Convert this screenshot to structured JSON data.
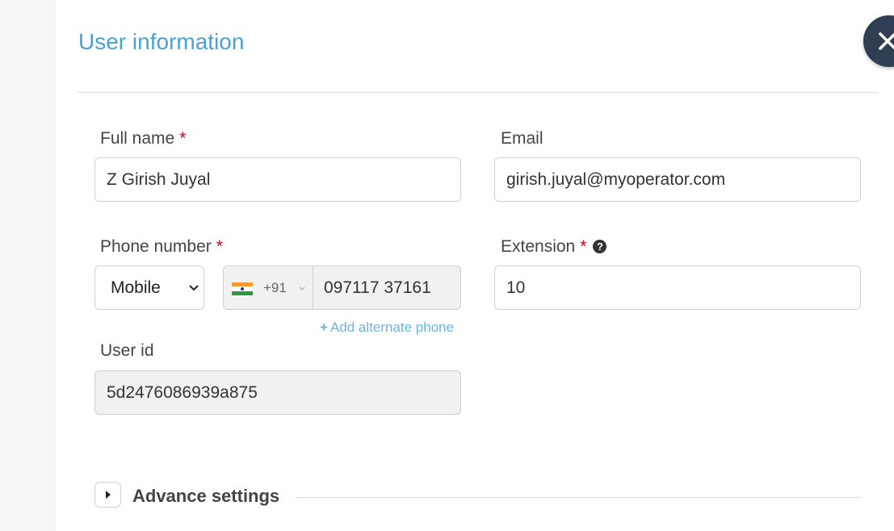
{
  "dialog": {
    "title": "User information"
  },
  "form": {
    "full_name": {
      "label": "Full name",
      "required_mark": "*",
      "value": "Z Girish Juyal"
    },
    "email": {
      "label": "Email",
      "value": "girish.juyal@myoperator.com"
    },
    "phone": {
      "label": "Phone number",
      "required_mark": "*",
      "type_selected": "Mobile",
      "country_flag": "india-flag",
      "dial_code": "+91",
      "number": "097117 37161",
      "add_alternate_label": "Add alternate phone",
      "add_alternate_icon": "+"
    },
    "extension": {
      "label": "Extension",
      "required_mark": "*",
      "help_icon": "?",
      "value": "10"
    },
    "user_id": {
      "label": "User id",
      "value": "5d2476086939a875"
    }
  },
  "advance_settings": {
    "label": "Advance settings"
  },
  "colors": {
    "title": "#4a9fd3",
    "required": "#d0021b",
    "link": "#6cb4e4",
    "close_button": "#2f3e53"
  }
}
